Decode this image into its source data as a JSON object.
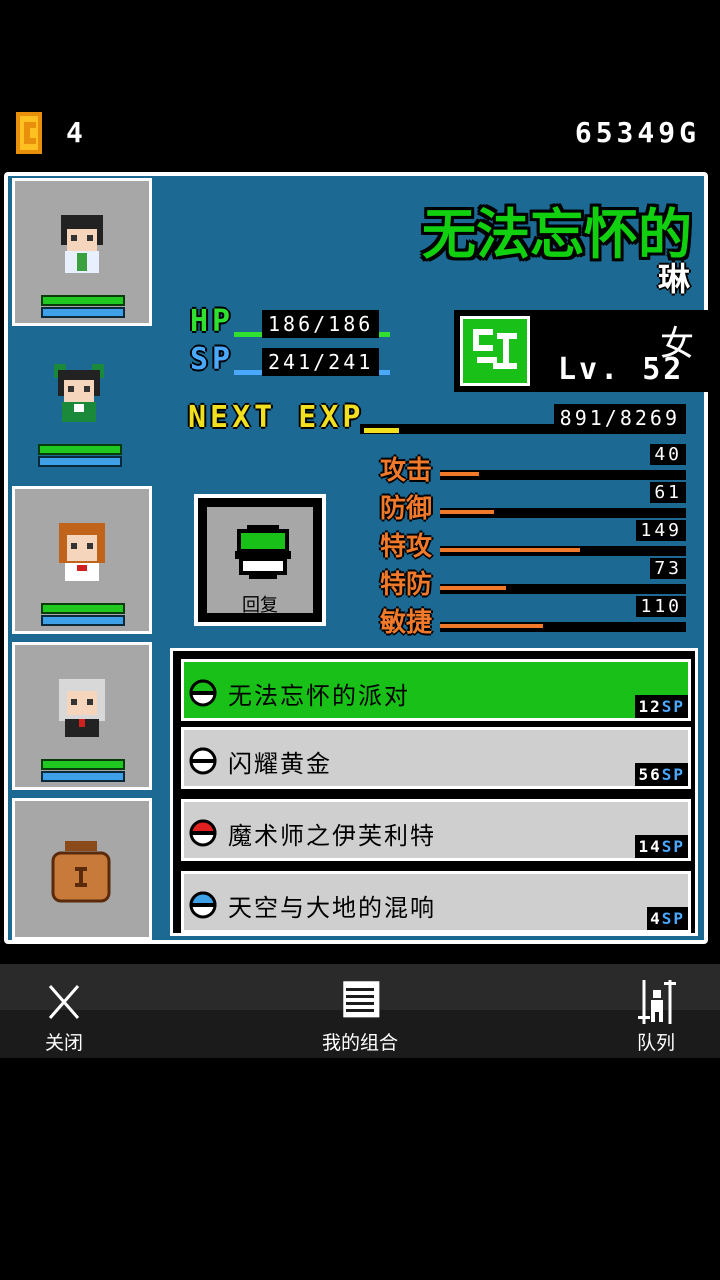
{
  "topbar": {
    "coin_count": "4",
    "gold": "65349G"
  },
  "character": {
    "title": "无法忘怀的",
    "name": "琳",
    "hp_label": "HP",
    "hp": "186/186",
    "sp_label": "SP",
    "sp": "241/241",
    "gender": "女",
    "level": "Lv. 52",
    "exp_label": "NEXT EXP",
    "exp": "891/8269",
    "exp_fraction": 0.108
  },
  "stats": [
    {
      "name": "攻击",
      "value": "40",
      "fraction": 0.16
    },
    {
      "name": "防御",
      "value": "61",
      "fraction": 0.22
    },
    {
      "name": "特攻",
      "value": "149",
      "fraction": 0.57
    },
    {
      "name": "特防",
      "value": "73",
      "fraction": 0.27
    },
    {
      "name": "敏捷",
      "value": "110",
      "fraction": 0.42
    }
  ],
  "recover": {
    "label": "回复"
  },
  "skills": [
    {
      "name": "无法忘怀的派对",
      "cost": "12",
      "unit": "SP",
      "ball_color": "#18c018"
    },
    {
      "name": "闪耀黄金",
      "cost": "56",
      "unit": "SP",
      "ball_color": "#ffffff"
    },
    {
      "name": "魔术师之伊芙利特",
      "cost": "14",
      "unit": "SP",
      "ball_color": "#e02020"
    },
    {
      "name": "天空与大地的混响",
      "cost": "4",
      "unit": "SP",
      "ball_color": "#3ea0e6"
    }
  ],
  "nav": {
    "close": "关闭",
    "combos": "我的组合",
    "party": "队列"
  },
  "colors": {
    "panel": "#1c6a93",
    "hp": "#2fe02f",
    "sp": "#4aa8ff",
    "exp": "#f0e020",
    "stat": "#f07a2a",
    "active_skill": "#18c018"
  }
}
